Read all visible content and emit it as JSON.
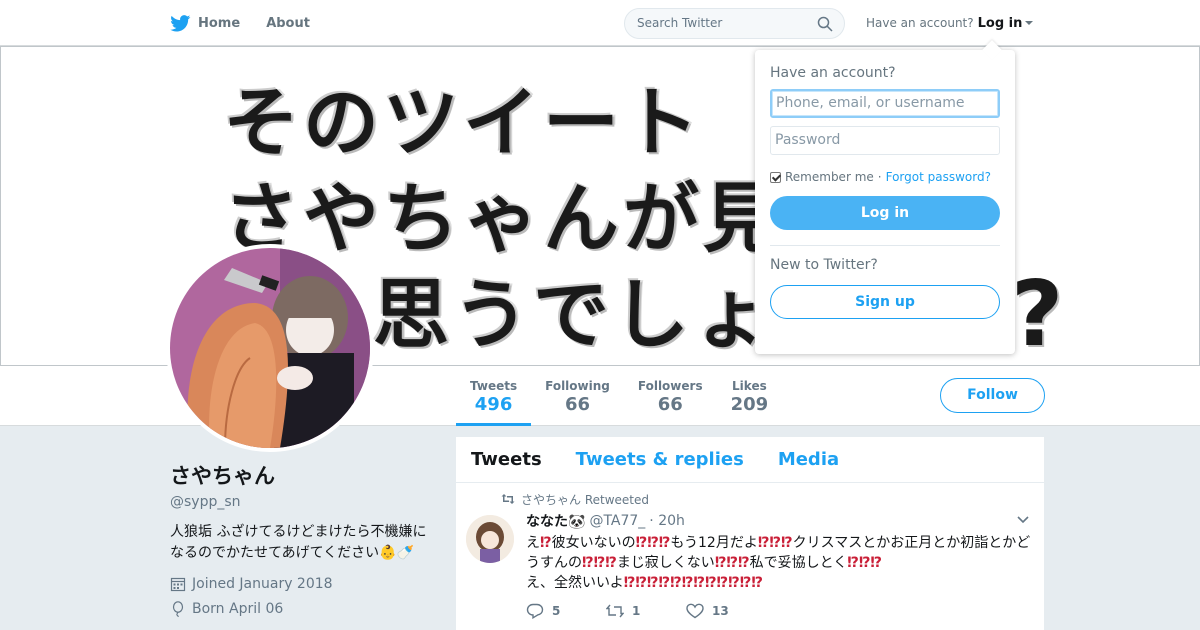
{
  "nav": {
    "home_label": "Home",
    "about_label": "About",
    "search_placeholder": "Search Twitter",
    "have_account": "Have an account?",
    "login_label": "Log in"
  },
  "banner": {
    "line1": "そのツイート",
    "line2": "さやちゃんが見",
    "line3": "思うでしょ",
    "mark": "?"
  },
  "stats": [
    {
      "label": "Tweets",
      "value": "496"
    },
    {
      "label": "Following",
      "value": "66"
    },
    {
      "label": "Followers",
      "value": "66"
    },
    {
      "label": "Likes",
      "value": "209"
    }
  ],
  "follow_label": "Follow",
  "profile": {
    "name": "さやちゃん",
    "handle": "@sypp_sn",
    "bio": "人狼垢 ふざけてるけどまけたら不機嫌になるのでかたせてあげてください👶🍼",
    "joined": "Joined January 2018",
    "born": "Born April 06"
  },
  "timeline": {
    "tabs": [
      "Tweets",
      "Tweets & replies",
      "Media"
    ],
    "tweet": {
      "retweeted_by": "さやちゃん Retweeted",
      "name": "ななた🐼",
      "handle": "@TA77_",
      "time": "· 20h",
      "text_parts": [
        "え",
        "⁉",
        "彼女いないの",
        "⁉⁉⁉",
        "もう12月だよ",
        "⁉⁉⁉",
        "クリスマスとかお正月とか初詣とかどうすんの",
        "⁉⁉⁉",
        "まじ寂しくない",
        "⁉⁉⁉",
        "私で妥協しとく",
        "⁉⁉⁉",
        "え、全然いいよ",
        "⁉⁉⁉⁉⁉⁉⁉⁉⁉⁉⁉⁉"
      ],
      "replies": "5",
      "retweets": "1",
      "likes": "13"
    }
  },
  "login": {
    "title": "Have an account?",
    "username_placeholder": "Phone, email, or username",
    "password_placeholder": "Password",
    "remember": "Remember me",
    "dot": " · ",
    "forgot": "Forgot password?",
    "login_button": "Log in",
    "new_label": "New to Twitter?",
    "signup_button": "Sign up"
  },
  "colors": {
    "accent": "#1da1f2",
    "emphasis": "#c91f37",
    "background": "#e6ecf0"
  }
}
